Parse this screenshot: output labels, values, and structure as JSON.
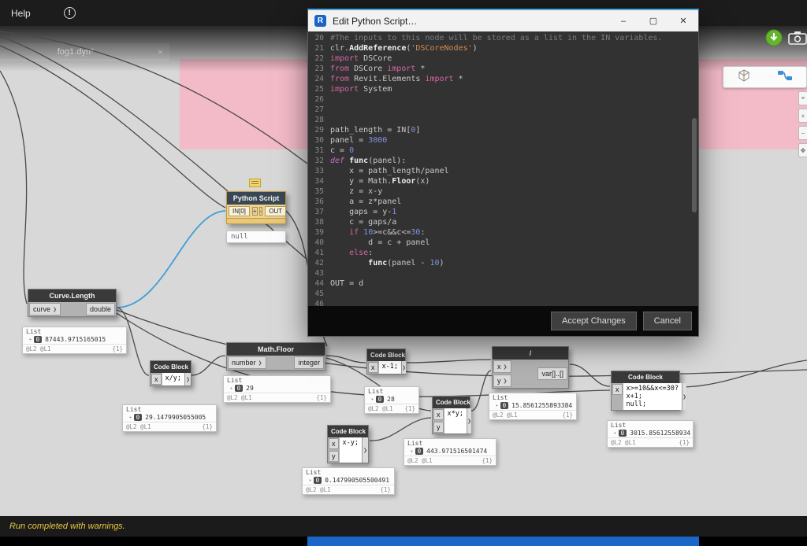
{
  "menu": {
    "help_label": "Help"
  },
  "tab": {
    "title": "fog1.dyn*"
  },
  "icons": {
    "notification": "!",
    "close_tab": "×",
    "minimize": "–",
    "maximize": "▢",
    "close": "✕",
    "caret": "▸",
    "chevron": "❯",
    "edge": [
      "⌖",
      "+",
      "−",
      "✥"
    ]
  },
  "colors": {
    "group_pink": "#f3bac8",
    "wire_selected": "#3f9fd8",
    "warning_text": "#e9c63d",
    "taskbar_blue": "#1b66c9",
    "editor_bg": "#323232"
  },
  "dialog": {
    "title": "Edit Python Script…",
    "icon_letter": "R",
    "buttons": {
      "accept": "Accept Changes",
      "cancel": "Cancel"
    },
    "code_lines": [
      {
        "n": 20,
        "tokens": [
          [
            "comment",
            "#The inputs to this node will be stored as a list in the IN variables."
          ]
        ]
      },
      {
        "n": 21,
        "tokens": [
          [
            "plain",
            "clr."
          ],
          [
            "func",
            "AddReference"
          ],
          [
            "plain",
            "("
          ],
          [
            "string",
            "'DSCoreNodes'"
          ],
          [
            "plain",
            ")"
          ]
        ]
      },
      {
        "n": 22,
        "tokens": [
          [
            "kw",
            "import"
          ],
          [
            "plain",
            " DSCore"
          ]
        ]
      },
      {
        "n": 23,
        "tokens": [
          [
            "kw",
            "from"
          ],
          [
            "plain",
            " DSCore "
          ],
          [
            "kw",
            "import"
          ],
          [
            "plain",
            " *"
          ]
        ]
      },
      {
        "n": 24,
        "tokens": [
          [
            "kw",
            "from"
          ],
          [
            "plain",
            " Revit.Elements "
          ],
          [
            "kw",
            "import"
          ],
          [
            "plain",
            " *"
          ]
        ]
      },
      {
        "n": 25,
        "tokens": [
          [
            "kw",
            "import"
          ],
          [
            "plain",
            " System"
          ]
        ]
      },
      {
        "n": 26,
        "tokens": []
      },
      {
        "n": 27,
        "tokens": []
      },
      {
        "n": 28,
        "tokens": []
      },
      {
        "n": 29,
        "tokens": [
          [
            "plain",
            "path_length = IN["
          ],
          [
            "num",
            "0"
          ],
          [
            "plain",
            "]"
          ]
        ]
      },
      {
        "n": 30,
        "tokens": [
          [
            "plain",
            "panel = "
          ],
          [
            "num",
            "3000"
          ]
        ]
      },
      {
        "n": 31,
        "tokens": [
          [
            "plain",
            "c = "
          ],
          [
            "num",
            "0"
          ]
        ]
      },
      {
        "n": 32,
        "tokens": [
          [
            "kwi",
            "def"
          ],
          [
            "plain",
            " "
          ],
          [
            "func",
            "func"
          ],
          [
            "plain",
            "(panel):"
          ]
        ]
      },
      {
        "n": 33,
        "tokens": [
          [
            "plain",
            "    x = path_length/panel"
          ]
        ]
      },
      {
        "n": 34,
        "tokens": [
          [
            "plain",
            "    y = Math."
          ],
          [
            "func",
            "Floor"
          ],
          [
            "plain",
            "(x)"
          ]
        ]
      },
      {
        "n": 35,
        "tokens": [
          [
            "plain",
            "    z = x-y"
          ]
        ]
      },
      {
        "n": 36,
        "tokens": [
          [
            "plain",
            "    a = z*panel"
          ]
        ]
      },
      {
        "n": 37,
        "tokens": [
          [
            "plain",
            "    gaps = y-"
          ],
          [
            "num",
            "1"
          ]
        ]
      },
      {
        "n": 38,
        "tokens": [
          [
            "plain",
            "    c = gaps/a"
          ]
        ]
      },
      {
        "n": 39,
        "tokens": [
          [
            "plain",
            "    "
          ],
          [
            "kw",
            "if"
          ],
          [
            "plain",
            " "
          ],
          [
            "num",
            "10"
          ],
          [
            "plain",
            ">=c&&c<="
          ],
          [
            "num",
            "30"
          ],
          [
            "plain",
            ":"
          ]
        ]
      },
      {
        "n": 40,
        "tokens": [
          [
            "plain",
            "        d = c + panel"
          ]
        ]
      },
      {
        "n": 41,
        "tokens": [
          [
            "plain",
            "    "
          ],
          [
            "kw",
            "else"
          ],
          [
            "plain",
            ":"
          ]
        ]
      },
      {
        "n": 42,
        "tokens": [
          [
            "plain",
            "        "
          ],
          [
            "func",
            "func"
          ],
          [
            "plain",
            "(panel - "
          ],
          [
            "num",
            "10"
          ],
          [
            "plain",
            ")"
          ]
        ]
      },
      {
        "n": 43,
        "tokens": []
      },
      {
        "n": 44,
        "tokens": [
          [
            "plain",
            "OUT = d"
          ]
        ]
      },
      {
        "n": 45,
        "tokens": []
      },
      {
        "n": 46,
        "tokens": []
      }
    ]
  },
  "nodes": {
    "python_script": {
      "title": "Python Script",
      "in0": "IN[0]",
      "add": "+",
      "remove": "-",
      "out": "OUT",
      "preview": "null"
    },
    "curve_length": {
      "title": "Curve.Length",
      "input": "curve",
      "output": "double",
      "preview": {
        "label": "List",
        "index": "0",
        "value": "87443.9715165015",
        "levels": "@L2 @L1",
        "count": "{1}"
      }
    },
    "code_block_div": {
      "title": "Code Block",
      "in_x": "x",
      "code": "x/y;",
      "preview": {
        "label": "List",
        "index": "0",
        "value": "29.1479905055005",
        "levels": "@L2 @L1",
        "count": "{1}"
      }
    },
    "math_floor": {
      "title": "Math.Floor",
      "input": "number",
      "output": "integer",
      "preview": {
        "label": "List",
        "index": "0",
        "value": "29",
        "levels": "@L2 @L1",
        "count": "{1}"
      }
    },
    "code_block_minus": {
      "title": "Code Block",
      "in_x": "x",
      "code": "x-1;",
      "preview": {
        "label": "List",
        "index": "0",
        "value": "28",
        "levels": "@L2 @L1",
        "count": "{1}"
      }
    },
    "code_block_mul": {
      "title": "Code Block",
      "in_x": "x",
      "in_y": "y",
      "code": "x*y;",
      "preview": {
        "label": "List",
        "index": "0",
        "value": "443.971516501474",
        "levels": "@L2 @L1",
        "count": "{1}"
      }
    },
    "code_block_sub": {
      "title": "Code Block",
      "in_x": "x",
      "in_y": "y",
      "code": "x-y;",
      "preview": {
        "label": "List",
        "index": "0",
        "value": "0.147990505500491",
        "levels": "@L2 @L1",
        "count": "{1}"
      }
    },
    "divide": {
      "title": "/",
      "in_x": "x",
      "in_y": "y",
      "output": "var[]..[]",
      "preview": {
        "label": "List",
        "index": "0",
        "value": "15.8561255893384",
        "levels": "@L2 @L1",
        "count": "{1}"
      }
    },
    "code_block_cond": {
      "title": "Code Block",
      "in_x": "x",
      "line1": "x>=10&&x<=30?",
      "line2": "x+1;",
      "line3": "null;",
      "preview": {
        "label": "List",
        "index": "0",
        "value": "3015.85612558934",
        "levels": "@L2 @L1",
        "count": "{1}"
      }
    }
  },
  "status": {
    "message": "Run completed with warnings."
  }
}
